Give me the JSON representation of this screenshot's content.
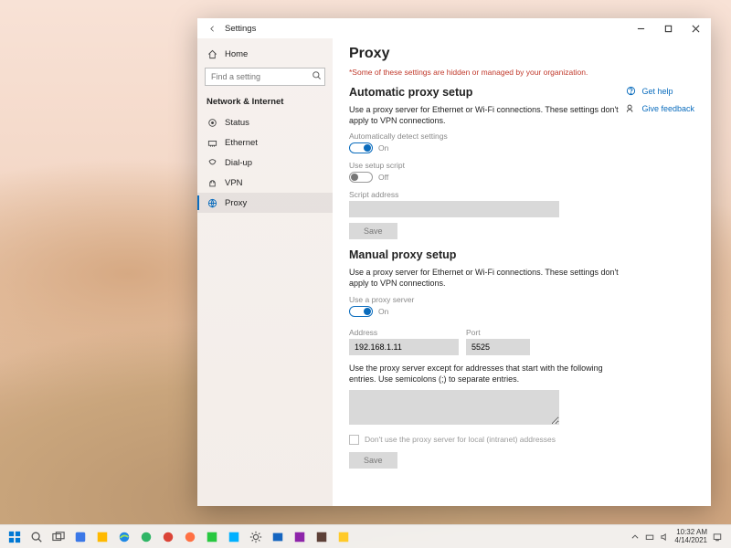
{
  "window": {
    "title": "Settings"
  },
  "sidebar": {
    "home": "Home",
    "search_placeholder": "Find a setting",
    "section": "Network & Internet",
    "items": [
      {
        "label": "Status",
        "icon": "status"
      },
      {
        "label": "Ethernet",
        "icon": "ethernet"
      },
      {
        "label": "Dial-up",
        "icon": "dialup"
      },
      {
        "label": "VPN",
        "icon": "vpn"
      },
      {
        "label": "Proxy",
        "icon": "proxy",
        "selected": true
      }
    ]
  },
  "page": {
    "heading": "Proxy",
    "disclaimer": "*Some of these settings are hidden or managed by your organization.",
    "auto": {
      "title": "Automatic proxy setup",
      "desc": "Use a proxy server for Ethernet or Wi-Fi connections. These settings don't apply to VPN connections.",
      "detect_label": "Automatically detect settings",
      "detect_state": "On",
      "script_label": "Use setup script",
      "script_state": "Off",
      "script_addr_label": "Script address",
      "script_addr_value": "",
      "save": "Save"
    },
    "manual": {
      "title": "Manual proxy setup",
      "desc": "Use a proxy server for Ethernet or Wi-Fi connections. These settings don't apply to VPN connections.",
      "use_label": "Use a proxy server",
      "use_state": "On",
      "address_label": "Address",
      "address_value": "192.168.1.11",
      "port_label": "Port",
      "port_value": "5525",
      "except_desc": "Use the proxy server except for addresses that start with the following entries. Use semicolons (;) to separate entries.",
      "except_value": "",
      "bypass_local": "Don't use the proxy server for local (intranet) addresses",
      "save": "Save"
    },
    "help": {
      "get_help": "Get help",
      "feedback": "Give feedback"
    }
  },
  "taskbar": {
    "time": "10:32 AM",
    "date": "4/14/2021"
  }
}
